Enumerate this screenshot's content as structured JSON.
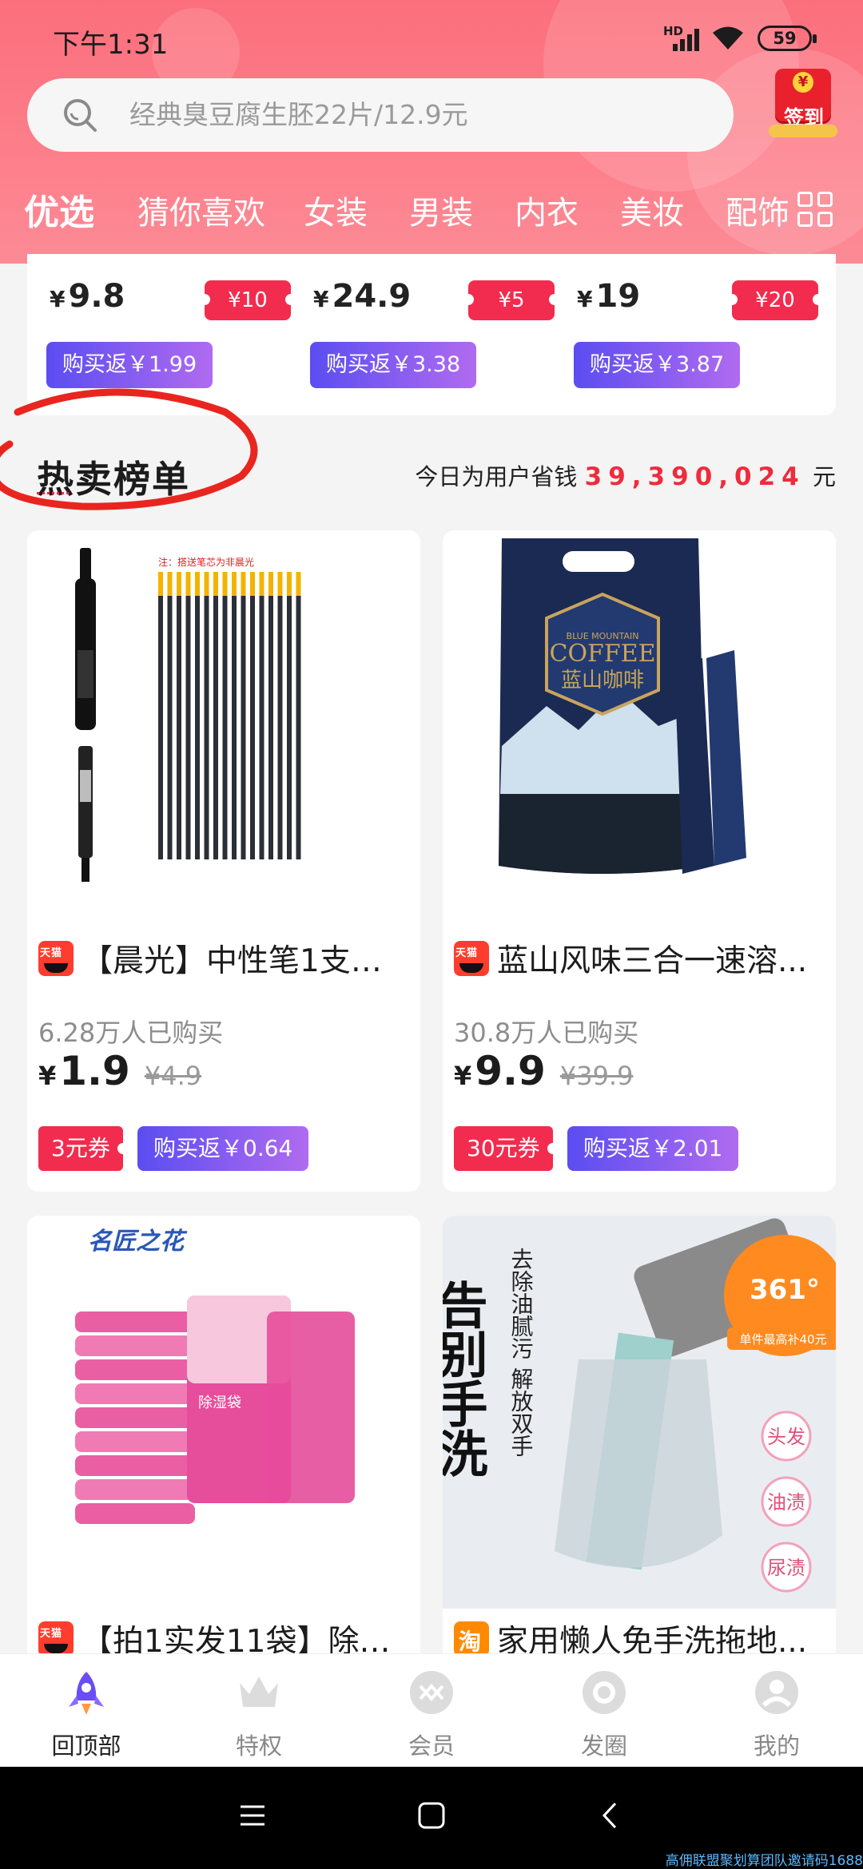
{
  "status": {
    "time": "下午1:31",
    "network": "HD",
    "battery": "59"
  },
  "search": {
    "placeholder": "经典臭豆腐生胚22片/12.9元"
  },
  "signin": {
    "label": "签到"
  },
  "tabs": [
    {
      "label": "优选",
      "active": true
    },
    {
      "label": "猜你喜欢"
    },
    {
      "label": "女装"
    },
    {
      "label": "男装"
    },
    {
      "label": "内衣"
    },
    {
      "label": "美妆"
    },
    {
      "label": "配饰"
    }
  ],
  "top_products": [
    {
      "price": "9.8",
      "coupon": "¥10",
      "rebate": "购买返￥1.99"
    },
    {
      "price": "24.9",
      "coupon": "¥5",
      "rebate": "购买返￥3.38"
    },
    {
      "price": "19",
      "coupon": "¥20",
      "rebate": "购买返￥3.87"
    }
  ],
  "hot": {
    "title": "热卖榜单",
    "savings_prefix": "今日为用户省钱",
    "savings_amount": "39,390,024",
    "savings_suffix": "元"
  },
  "products": [
    {
      "platform": "tmall",
      "title": "【晨光】中性笔1支+...",
      "sold": "6.28万人已购买",
      "price": "1.9",
      "orig": "¥4.9",
      "coupon": "3元券",
      "rebate": "购买返￥0.64",
      "image_text": "注：搭送笔芯为非晨光"
    },
    {
      "platform": "tmall",
      "title": "蓝山风味三合一速溶...",
      "sold": "30.8万人已购买",
      "price": "9.9",
      "orig": "¥39.9",
      "coupon": "30元券",
      "rebate": "购买返￥2.01",
      "image_text": "COFFEE",
      "image_subtext": "蓝山咖啡",
      "image_brand": "BLUE MOUNTAIN"
    },
    {
      "platform": "tmall",
      "title": "【拍1实发11袋】除湿...",
      "image_text": "名匠之花",
      "image_label": "除湿袋"
    },
    {
      "platform": "taobao",
      "title": "家用懒人免手洗拖地...",
      "image_text": "告别手洗",
      "image_sub1": "去除油腻污",
      "image_sub2": "解放双手",
      "image_badge": "361°",
      "image_badge2": "单件最高补40元",
      "image_tags": [
        "头发",
        "油渍",
        "尿渍"
      ]
    }
  ],
  "bottom_nav": [
    {
      "label": "回顶部",
      "active": true
    },
    {
      "label": "特权"
    },
    {
      "label": "会员"
    },
    {
      "label": "发圈"
    },
    {
      "label": "我的"
    }
  ],
  "watermark": "高佣联盟聚划算团队邀请码1688",
  "colors": {
    "header": "#fc7a86",
    "accent": "#ee2c3c",
    "rebate_start": "#5b4df1",
    "rebate_end": "#b06bf0"
  }
}
